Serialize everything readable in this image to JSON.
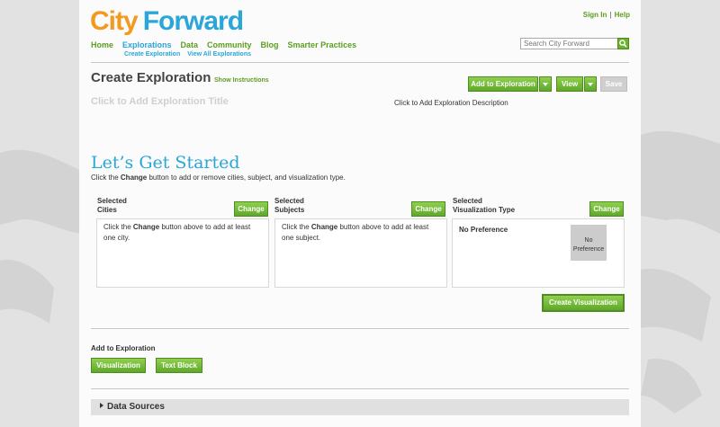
{
  "brand": {
    "word1": "City",
    "word2": "Forward"
  },
  "header": {
    "signin": "Sign In",
    "help": "Help",
    "search_placeholder": "Search City Forward"
  },
  "nav": {
    "items": [
      "Home",
      "Explorations",
      "Data",
      "Community",
      "Blog",
      "Smarter Practices"
    ],
    "subitems": [
      "Create Exploration",
      "View All Explorations"
    ]
  },
  "exploration": {
    "title": "Create Exploration",
    "show_instructions": "Show Instructions",
    "add_to_exploration_btn": "Add to Exploration",
    "view_btn": "View",
    "save_btn": "Save",
    "title_placeholder": "Click to Add Exploration Title",
    "description_placeholder": "Click to Add Exploration Description"
  },
  "get_started": {
    "heading": "Let’s Get Started",
    "instr_pre": "Click the ",
    "instr_bold": "Change",
    "instr_post": " button to add or remove cities, subject, and visualization type."
  },
  "columns": {
    "cities": {
      "title_line1": "Selected",
      "title_line2": "Cities",
      "change": "Change",
      "hint_pre": "Click the ",
      "hint_bold": "Change",
      "hint_post": " button above to add at least one city."
    },
    "subjects": {
      "title_line1": "Selected",
      "title_line2": "Subjects",
      "change": "Change",
      "hint_pre": "Click the ",
      "hint_bold": "Change",
      "hint_post": " button above to add at least one subject."
    },
    "vis_type": {
      "title_line1": "Selected",
      "title_line2": "Visualization Type",
      "change": "Change",
      "selected_label": "No Preference",
      "tile_line1": "No",
      "tile_line2": "Preference"
    }
  },
  "create_visualization": "Create Visualization",
  "add_section": {
    "label": "Add to Exploration",
    "visualization_btn": "Visualization",
    "text_block_btn": "Text Block"
  },
  "data_sources": "Data Sources",
  "colors": {
    "orange": "#f39a1e",
    "blue": "#2aa6d8",
    "green": "#6cb22e",
    "link_green": "#5c9e1e"
  }
}
